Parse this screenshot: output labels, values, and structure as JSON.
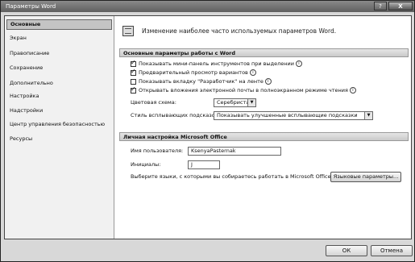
{
  "window": {
    "title": "Параметры Word",
    "help_label": "?",
    "close_label": "X"
  },
  "sidebar": {
    "items": [
      {
        "label": "Основные",
        "active": true
      },
      {
        "label": "Экран"
      },
      {
        "label": "Правописание"
      },
      {
        "label": "Сохранение"
      },
      {
        "label": "Дополнительно"
      },
      {
        "label": "Настройка"
      },
      {
        "label": "Надстройки"
      },
      {
        "label": "Центр управления безопасностью"
      },
      {
        "label": "Ресурсы"
      }
    ]
  },
  "header": {
    "text": "Изменение наиболее часто используемых параметров Word.",
    "icon": "options-icon"
  },
  "basic": {
    "title": "Основные параметры работы с Word",
    "checkboxes": [
      {
        "label": "Показывать мини-панель инструментов при выделении",
        "checked": true,
        "info": "ⓘ"
      },
      {
        "label": "Предварительный просмотр вариантов",
        "checked": true,
        "info": "ⓘ"
      },
      {
        "label": "Показывать вкладку \"Разработчик\" на ленте",
        "checked": false,
        "info": "ⓘ"
      },
      {
        "label": "Открывать вложения электронной почты в полноэкранном режиме чтения",
        "checked": true,
        "info": "ⓘ"
      }
    ],
    "color_scheme_label": "Цветовая схема:",
    "color_scheme_value": "Серебристая",
    "tooltip_style_label": "Стиль всплывающих подсказок:",
    "tooltip_style_value": "Показывать улучшенные всплывающие подсказки"
  },
  "personal": {
    "title": "Личная настройка Microsoft Office",
    "username_label": "Имя пользователя:",
    "username_value": "KsenyaPasternak",
    "initials_label": "Инициалы:",
    "initials_value": "J",
    "languages_text": "Выберите языки, с которыми вы собираетесь работать в Microsoft Office:",
    "languages_button": "Языковые параметры..."
  },
  "footer": {
    "ok_label": "ОК",
    "cancel_label": "Отмена"
  },
  "colors": {
    "title_bar": "#6f6f6f",
    "window_bg": "#d8d8d8",
    "sidebar_bg": "#f1f1f1",
    "section_bg": "#d6d6d6"
  }
}
